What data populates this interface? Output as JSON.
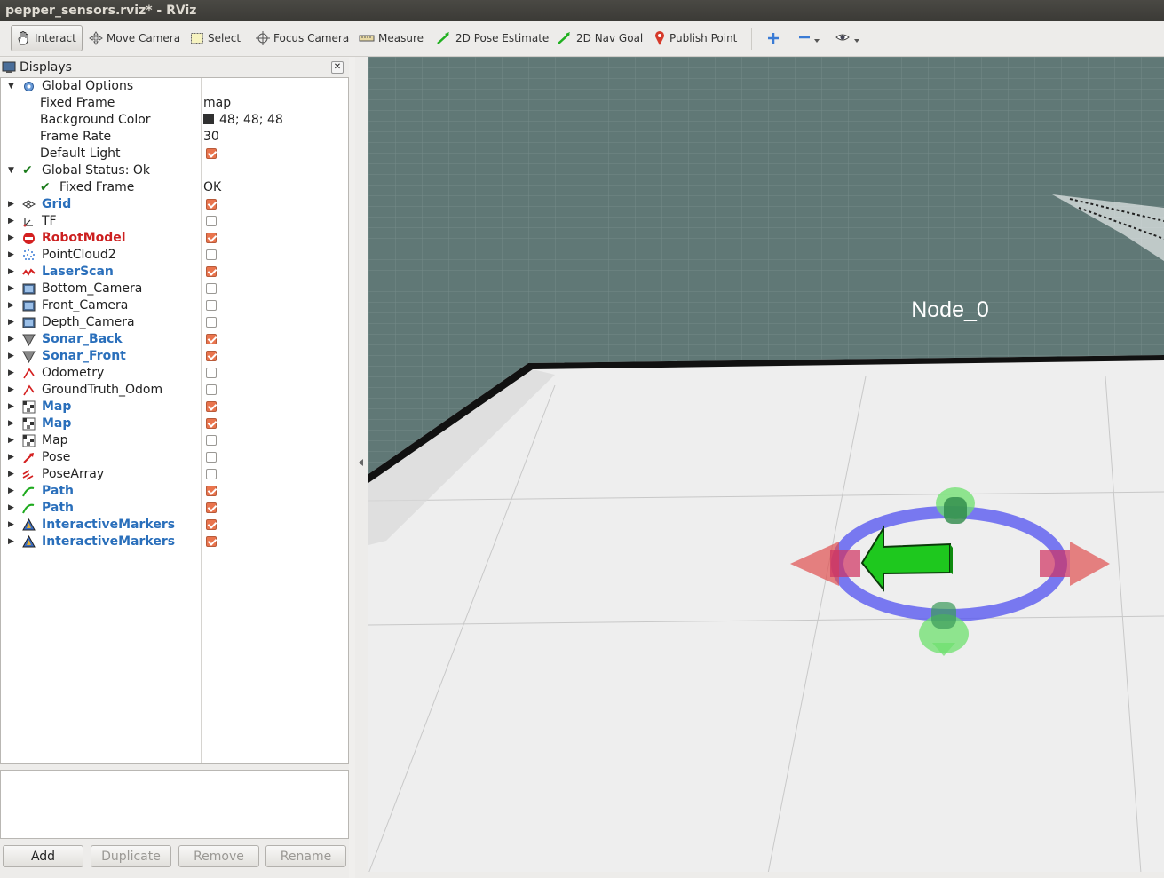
{
  "window": {
    "title": "pepper_sensors.rviz* - RViz"
  },
  "toolbar": {
    "tools": [
      {
        "label": "Interact",
        "icon": "hand-icon"
      },
      {
        "label": "Move Camera",
        "icon": "move-camera-icon"
      },
      {
        "label": "Select",
        "icon": "select-icon"
      },
      {
        "label": "Focus Camera",
        "icon": "focus-camera-icon"
      },
      {
        "label": "Measure",
        "icon": "ruler-icon"
      },
      {
        "label": "2D Pose Estimate",
        "icon": "pose-estimate-icon"
      },
      {
        "label": "2D Nav Goal",
        "icon": "nav-goal-icon"
      },
      {
        "label": "Publish Point",
        "icon": "map-pin-icon"
      }
    ],
    "extra": [
      "plus-icon",
      "minus-dropdown-icon",
      "eye-dropdown-icon"
    ],
    "active": "Interact"
  },
  "displays": {
    "title": "Displays",
    "global_options": {
      "label": "Global Options",
      "props": [
        {
          "name": "Fixed Frame",
          "value": "map"
        },
        {
          "name": "Background Color",
          "value": "48; 48; 48",
          "swatch": "#303030"
        },
        {
          "name": "Frame Rate",
          "value": "30"
        },
        {
          "name": "Default Light",
          "checked": true
        }
      ]
    },
    "global_status": {
      "label": "Global Status: Ok",
      "child": {
        "name": "Fixed Frame",
        "value": "OK"
      }
    },
    "items": [
      {
        "label": "Grid",
        "style": "blue",
        "icon": "grid-icon",
        "checked": true
      },
      {
        "label": "TF",
        "style": "normal",
        "icon": "tf-axes-icon",
        "checked": false
      },
      {
        "label": "RobotModel",
        "style": "red",
        "icon": "error-icon",
        "checked": true
      },
      {
        "label": "PointCloud2",
        "style": "normal",
        "icon": "pointcloud-icon",
        "checked": false
      },
      {
        "label": "LaserScan",
        "style": "blue",
        "icon": "laserscan-icon",
        "checked": true
      },
      {
        "label": "Bottom_Camera",
        "style": "normal",
        "icon": "camera-image-icon",
        "checked": false
      },
      {
        "label": "Front_Camera",
        "style": "normal",
        "icon": "camera-image-icon",
        "checked": false
      },
      {
        "label": "Depth_Camera",
        "style": "normal",
        "icon": "camera-image-icon",
        "checked": false
      },
      {
        "label": "Sonar_Back",
        "style": "blue",
        "icon": "sonar-cone-icon",
        "checked": true
      },
      {
        "label": "Sonar_Front",
        "style": "blue",
        "icon": "sonar-cone-icon",
        "checked": true
      },
      {
        "label": "Odometry",
        "style": "normal",
        "icon": "odometry-icon",
        "checked": false
      },
      {
        "label": "GroundTruth_Odom",
        "style": "normal",
        "icon": "odometry-icon",
        "checked": false
      },
      {
        "label": "Map",
        "style": "blue",
        "icon": "map-grid-icon",
        "checked": true
      },
      {
        "label": "Map",
        "style": "blue",
        "icon": "map-grid-icon",
        "checked": true
      },
      {
        "label": "Map",
        "style": "normal",
        "icon": "map-grid-icon",
        "checked": false
      },
      {
        "label": "Pose",
        "style": "normal",
        "icon": "pose-arrow-icon",
        "checked": false
      },
      {
        "label": "PoseArray",
        "style": "normal",
        "icon": "pose-array-icon",
        "checked": false
      },
      {
        "label": "Path",
        "style": "blue",
        "icon": "path-icon",
        "checked": true
      },
      {
        "label": "Path",
        "style": "blue",
        "icon": "path-icon",
        "checked": true
      },
      {
        "label": "InteractiveMarkers",
        "style": "blue",
        "icon": "interactive-marker-icon",
        "checked": true
      },
      {
        "label": "InteractiveMarkers",
        "style": "blue",
        "icon": "interactive-marker-icon",
        "checked": true
      }
    ],
    "buttons": {
      "add": "Add",
      "duplicate": "Duplicate",
      "remove": "Remove",
      "rename": "Rename"
    }
  },
  "viewport": {
    "marker_label": "Node_0",
    "colors": {
      "map_fill": "#607876",
      "floor": "#efefef",
      "ring": "#5a5af0",
      "arrow_green": "#1ec81e",
      "arrow_red": "#e05050"
    }
  }
}
